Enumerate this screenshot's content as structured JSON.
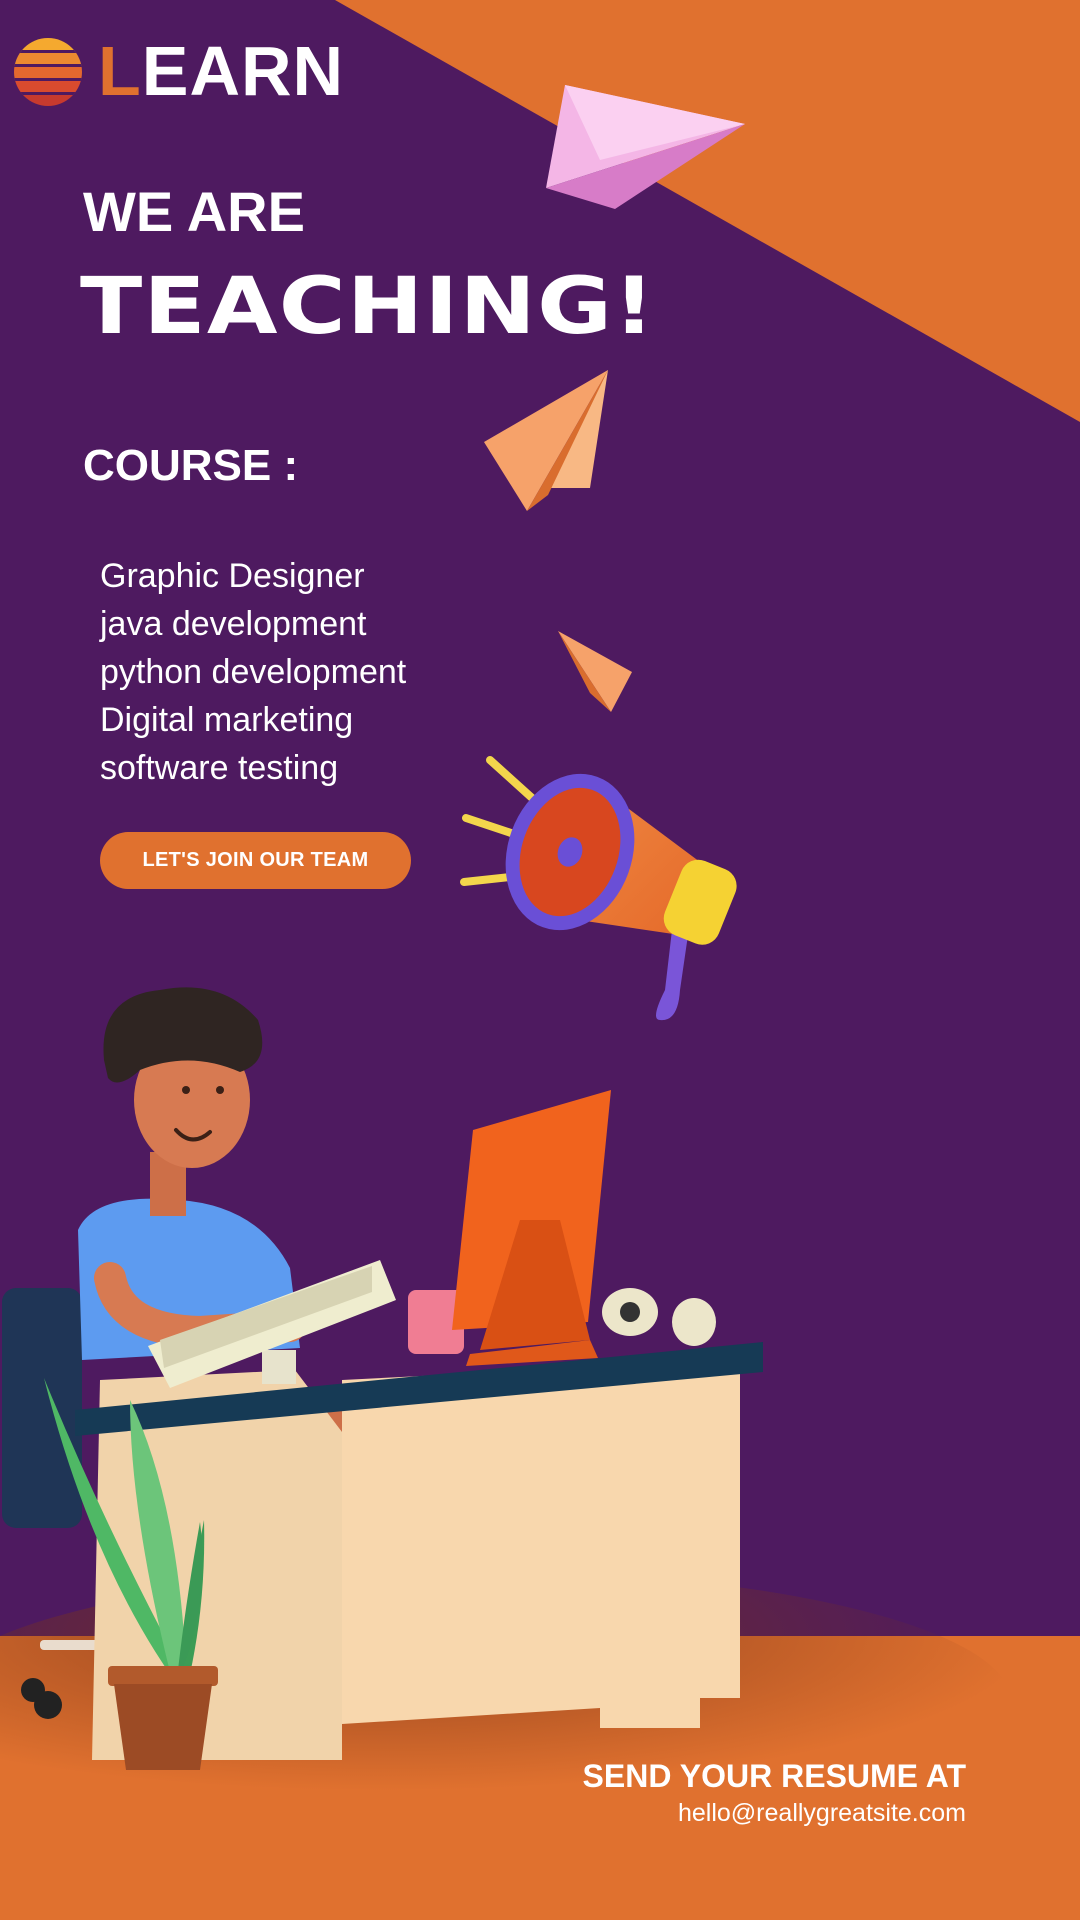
{
  "brand": {
    "logo_first_letter": "L",
    "logo_rest": "EARN",
    "logo_icon": "striped-sun-icon"
  },
  "hero": {
    "line1": "WE ARE",
    "line2": "TEACHING!"
  },
  "course": {
    "label": "COURSE :",
    "items": [
      "Graphic Designer",
      "java development",
      "python development",
      "Digital marketing",
      "software testing"
    ]
  },
  "cta": {
    "label": "LET'S JOIN OUR TEAM"
  },
  "contact": {
    "heading": "SEND YOUR RESUME AT",
    "email": "hello@reallygreatsite.com"
  },
  "colors": {
    "background": "#4e1a60",
    "accent": "#e0712f",
    "text": "#ffffff"
  },
  "illustrations": [
    "paper-plane-icon",
    "megaphone-icon",
    "person-at-desk-illustration",
    "potted-plant-icon"
  ]
}
